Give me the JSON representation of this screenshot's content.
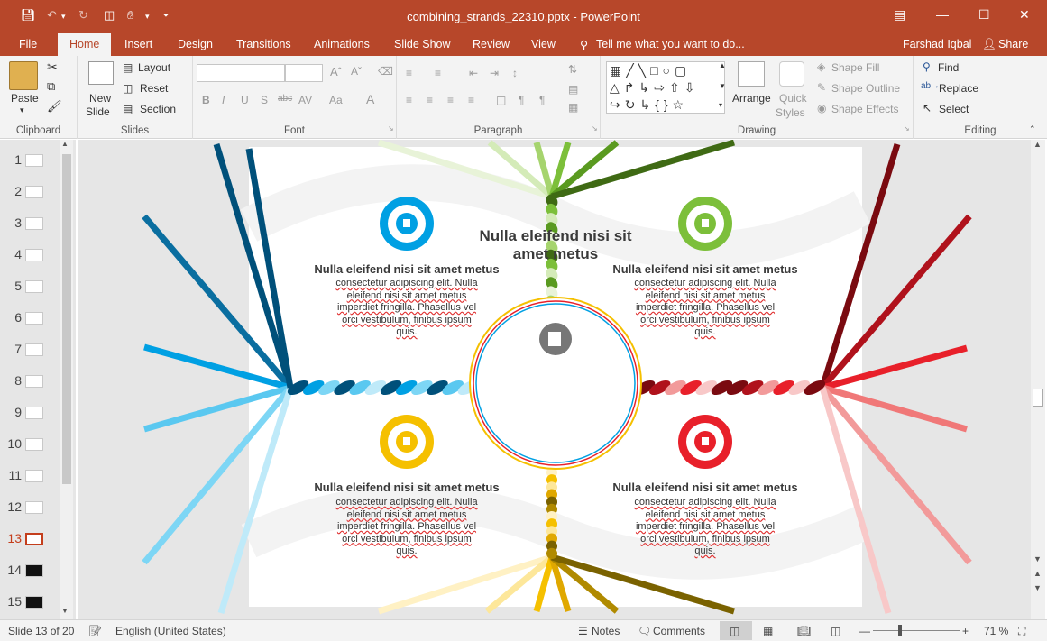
{
  "title_bar": {
    "window_title": "combining_strands_22310.pptx - PowerPoint",
    "qat_icons": [
      "save-icon",
      "undo-icon",
      "redo-icon",
      "presenter-icon",
      "touch-mode-icon",
      "customize-qat-icon"
    ]
  },
  "tabs": [
    "File",
    "Home",
    "Insert",
    "Design",
    "Transitions",
    "Animations",
    "Slide Show",
    "Review",
    "View"
  ],
  "active_tab": "Home",
  "tell_me": "Tell me what you want to do...",
  "user": "Farshad Iqbal",
  "share": "Share",
  "ribbon": {
    "clipboard": {
      "label": "Clipboard",
      "paste": "Paste"
    },
    "slides": {
      "label": "Slides",
      "new_slide_1": "New",
      "new_slide_2": "Slide",
      "layout": "Layout",
      "reset": "Reset",
      "section": "Section"
    },
    "font": {
      "label": "Font",
      "font_name": "",
      "font_size": ""
    },
    "paragraph": {
      "label": "Paragraph"
    },
    "drawing": {
      "label": "Drawing",
      "arrange": "Arrange",
      "quick_styles_1": "Quick",
      "quick_styles_2": "Styles",
      "shape_fill": "Shape Fill",
      "shape_outline": "Shape Outline",
      "shape_effects": "Shape Effects"
    },
    "editing": {
      "label": "Editing",
      "find": "Find",
      "replace": "Replace",
      "select": "Select"
    }
  },
  "thumbnails": [
    "1",
    "2",
    "3",
    "4",
    "5",
    "6",
    "7",
    "8",
    "9",
    "10",
    "11",
    "12",
    "13",
    "14",
    "15"
  ],
  "selected_slide": "13",
  "slide": {
    "center_title": "Nulla eleifend nisi sit amet metus",
    "cards": [
      {
        "title": "Nulla eleifend nisi sit amet metus",
        "lines": [
          "consectetur adipiscing elit. Nulla",
          "eleifend nisi sit amet metus",
          "imperdiet fringilla. Phasellus vel",
          "orci vestibulum, finibus ipsum",
          "quis."
        ],
        "color": "#00a0e3"
      },
      {
        "title": "Nulla eleifend nisi sit amet metus",
        "lines": [
          "consectetur adipiscing elit. Nulla",
          "eleifend nisi sit amet metus",
          "imperdiet fringilla. Phasellus vel",
          "orci vestibulum, finibus ipsum",
          "quis."
        ],
        "color": "#7cbf3a"
      },
      {
        "title": "Nulla eleifend nisi sit amet metus",
        "lines": [
          "consectetur adipiscing elit. Nulla",
          "eleifend nisi sit amet metus",
          "imperdiet fringilla. Phasellus vel",
          "orci vestibulum, finibus ipsum",
          "quis."
        ],
        "color": "#f5c000"
      },
      {
        "title": "Nulla eleifend nisi sit amet metus",
        "lines": [
          "consectetur adipiscing elit. Nulla",
          "eleifend nisi sit amet metus",
          "imperdiet fringilla. Phasellus vel",
          "orci vestibulum, finibus ipsum",
          "quis."
        ],
        "color": "#e8202a"
      }
    ]
  },
  "status": {
    "slide_info": "Slide 13 of 20",
    "language": "English (United States)",
    "notes": "Notes",
    "comments": "Comments",
    "zoom": "71 %"
  }
}
